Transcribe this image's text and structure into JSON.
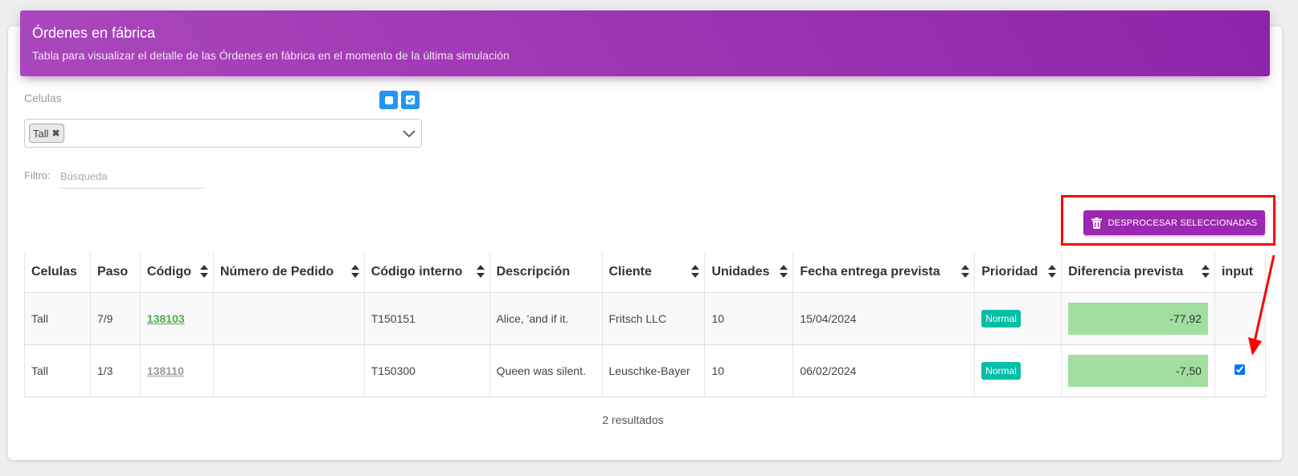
{
  "header": {
    "title": "Órdenes en fábrica",
    "subtitle": "Tabla para visualizar el detalle de las Órdenes en fábrica en el momento de la última simulación"
  },
  "celulas": {
    "label": "Celulas",
    "selected_chip": "Tall",
    "remove_glyph": "✖"
  },
  "filtro": {
    "label": "Filtro:",
    "placeholder": "Búsqueda",
    "value": ""
  },
  "actions": {
    "desprocesar_label": "DESPROCESAR SELECCIONADAS"
  },
  "table": {
    "columns": [
      "Celulas",
      "Paso",
      "Código",
      "Número de Pedido",
      "Código interno",
      "Descripción",
      "Cliente",
      "Unidades",
      "Fecha entrega prevista",
      "Prioridad",
      "Diferencia prevista",
      "input"
    ],
    "rows": [
      {
        "celulas": "Tall",
        "paso": "7/9",
        "codigo": "138103",
        "numero_pedido": "",
        "codigo_interno": "T150151",
        "descripcion": "Alice, 'and if it.",
        "cliente": "Fritsch LLC",
        "unidades": "10",
        "fecha": "15/04/2024",
        "prioridad": "Normal",
        "diferencia": "-77,92",
        "checked": false
      },
      {
        "celulas": "Tall",
        "paso": "1/3",
        "codigo": "138110",
        "numero_pedido": "",
        "codigo_interno": "T150300",
        "descripcion": "Queen was silent.",
        "cliente": "Leuschke-Bayer",
        "unidades": "10",
        "fecha": "06/02/2024",
        "prioridad": "Normal",
        "diferencia": "-7,50",
        "checked": true
      }
    ]
  },
  "footer": {
    "results": "2 resultados"
  },
  "colors": {
    "header_purple": "#9c27b0",
    "accent_blue": "#2196f3",
    "badge_teal": "#00bfa5",
    "diff_green": "#a1dea0",
    "highlight_red": "#ff0000"
  },
  "icons": [
    "square-icon",
    "check-square-icon",
    "close-icon",
    "chevron-down-icon",
    "trash-icon",
    "sort-icon",
    "red-arrow-annotation"
  ]
}
